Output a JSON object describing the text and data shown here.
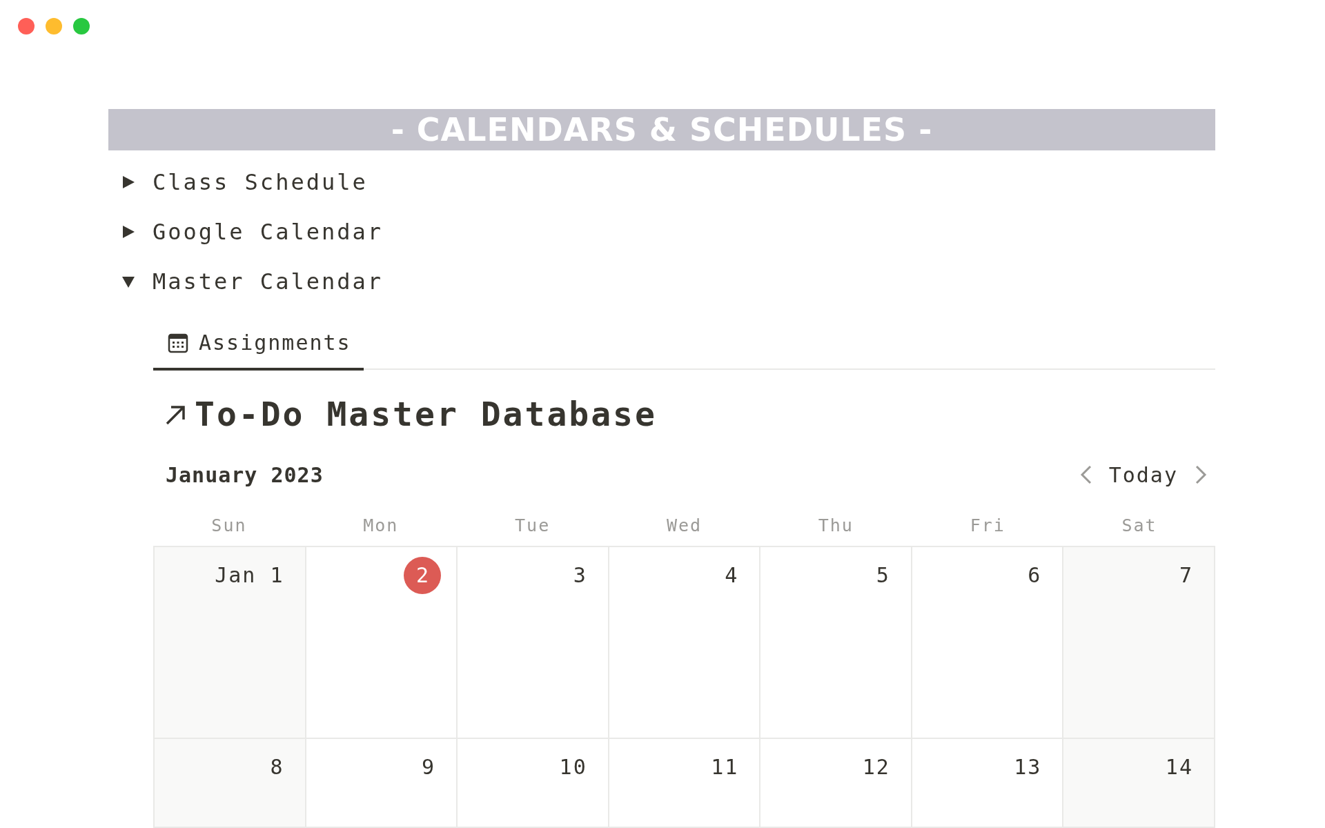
{
  "window": {
    "controls": [
      {
        "color": "#ff5f57"
      },
      {
        "color": "#febc2e"
      },
      {
        "color": "#28c840"
      }
    ]
  },
  "banner": {
    "title": "- CALENDARS & SCHEDULES -"
  },
  "toggles": [
    {
      "label": "Class Schedule",
      "expanded": false
    },
    {
      "label": "Google Calendar",
      "expanded": false
    },
    {
      "label": "Master Calendar",
      "expanded": true
    }
  ],
  "tabs": [
    {
      "label": "Assignments",
      "selected": true
    }
  ],
  "database": {
    "title": "To-Do Master Database"
  },
  "calendar": {
    "month": "January 2023",
    "today_button": "Today",
    "weekdays": [
      "Sun",
      "Mon",
      "Tue",
      "Wed",
      "Thu",
      "Fri",
      "Sat"
    ],
    "weeks": [
      [
        {
          "label": "Jan 1",
          "today": false
        },
        {
          "label": "2",
          "today": true
        },
        {
          "label": "3",
          "today": false
        },
        {
          "label": "4",
          "today": false
        },
        {
          "label": "5",
          "today": false
        },
        {
          "label": "6",
          "today": false
        },
        {
          "label": "7",
          "today": false
        }
      ],
      [
        {
          "label": "8",
          "today": false
        },
        {
          "label": "9",
          "today": false
        },
        {
          "label": "10",
          "today": false
        },
        {
          "label": "11",
          "today": false
        },
        {
          "label": "12",
          "today": false
        },
        {
          "label": "13",
          "today": false
        },
        {
          "label": "14",
          "today": false
        }
      ]
    ]
  }
}
